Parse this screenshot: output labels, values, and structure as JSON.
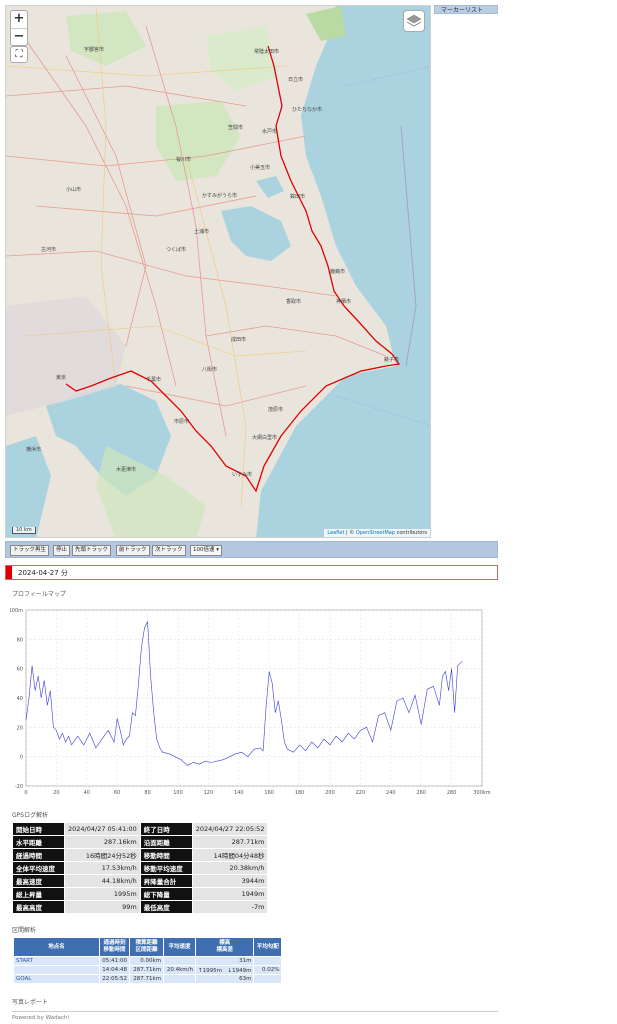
{
  "map": {
    "zoom_in": "+",
    "zoom_out": "−",
    "fullscreen": "⛶",
    "scale_label": "10 km",
    "attribution_leaflet": "Leaflet",
    "attribution_sep": " | © ",
    "attribution_osm": "OpenStreetMap",
    "attribution_tail": " contributors",
    "labels": [
      {
        "text": "宇都宮市"
      },
      {
        "text": "常陸太田市"
      },
      {
        "text": "日立市"
      },
      {
        "text": "ひたちなか市"
      },
      {
        "text": "水戸市"
      },
      {
        "text": "笠間市"
      },
      {
        "text": "小美玉市"
      },
      {
        "text": "鉾田市"
      },
      {
        "text": "かすみがうら市"
      },
      {
        "text": "土浦市"
      },
      {
        "text": "つくば市"
      },
      {
        "text": "鹿嶋市"
      },
      {
        "text": "神栖市"
      },
      {
        "text": "香取市"
      },
      {
        "text": "銚子市"
      },
      {
        "text": "成田市"
      },
      {
        "text": "八街市"
      },
      {
        "text": "千葉市"
      },
      {
        "text": "東京"
      },
      {
        "text": "市原市"
      },
      {
        "text": "茂原市"
      },
      {
        "text": "木更津市"
      },
      {
        "text": "大網白里市"
      },
      {
        "text": "いすみ市"
      },
      {
        "text": "横浜市"
      },
      {
        "text": "小山市"
      },
      {
        "text": "古河市"
      },
      {
        "text": "桜川市"
      }
    ]
  },
  "marker_list": {
    "title": "マーカーリスト"
  },
  "toolbar": {
    "play_track": "トラック再生",
    "stop": "停止",
    "first_track": "先頭トラック",
    "prev_track": "前トラック",
    "next_track": "次トラック",
    "speed_select": "100倍速"
  },
  "date_bar": {
    "label": "2024-04-27 分"
  },
  "profile": {
    "title": "プロフィールマップ",
    "y_unit": "m",
    "x_unit": "km"
  },
  "chart_data": {
    "type": "line",
    "title": "",
    "xlabel": "",
    "ylabel": "",
    "xlim": [
      0,
      300
    ],
    "ylim": [
      -20,
      100
    ],
    "xticks": [
      0,
      20,
      40,
      60,
      80,
      100,
      120,
      140,
      160,
      180,
      200,
      220,
      240,
      260,
      280,
      300
    ],
    "yticks": [
      -20,
      0,
      20,
      40,
      60,
      80,
      100
    ],
    "grid": true,
    "series": [
      {
        "color": "#3b3bdc",
        "x": [
          0,
          2,
          4,
          6,
          8,
          10,
          12,
          14,
          16,
          18,
          20,
          22,
          24,
          26,
          28,
          30,
          34,
          38,
          42,
          46,
          50,
          54,
          58,
          60,
          62,
          64,
          66,
          68,
          70,
          72,
          74,
          76,
          78,
          80,
          82,
          84,
          86,
          88,
          90,
          94,
          98,
          102,
          106,
          110,
          114,
          118,
          122,
          126,
          130,
          134,
          138,
          142,
          146,
          150,
          154,
          156,
          158,
          160,
          162,
          164,
          166,
          168,
          170,
          172,
          176,
          180,
          184,
          188,
          192,
          196,
          200,
          204,
          208,
          212,
          216,
          220,
          224,
          228,
          232,
          236,
          240,
          244,
          248,
          252,
          256,
          260,
          264,
          268,
          272,
          274,
          276,
          278,
          280,
          282,
          284,
          287
        ],
        "y": [
          25,
          40,
          62,
          45,
          55,
          40,
          52,
          35,
          45,
          20,
          18,
          12,
          16,
          10,
          14,
          8,
          14,
          8,
          16,
          6,
          12,
          18,
          10,
          26,
          18,
          8,
          12,
          14,
          30,
          28,
          50,
          75,
          88,
          92,
          55,
          30,
          12,
          6,
          3,
          2,
          0,
          -2,
          -6,
          -4,
          -5,
          -3,
          -4,
          -3,
          -2,
          0,
          2,
          3,
          0,
          5,
          6,
          4,
          35,
          58,
          50,
          30,
          38,
          25,
          10,
          5,
          3,
          8,
          4,
          10,
          6,
          12,
          8,
          14,
          10,
          16,
          12,
          18,
          20,
          10,
          28,
          30,
          18,
          38,
          40,
          30,
          42,
          22,
          46,
          48,
          35,
          55,
          58,
          45,
          60,
          30,
          62,
          65
        ]
      }
    ]
  },
  "gps": {
    "title": "GPSログ解析",
    "rows": [
      {
        "l1": "開始日時",
        "v1": "2024/04/27 05:41:00",
        "l2": "終了日時",
        "v2": "2024/04/27 22:05:52"
      },
      {
        "l1": "水平距離",
        "v1": "287.16km",
        "l2": "沿面距離",
        "v2": "287.71km"
      },
      {
        "l1": "経過時間",
        "v1": "16時間24分52秒",
        "l2": "移動時間",
        "v2": "14時間04分48秒"
      },
      {
        "l1": "全体平均速度",
        "v1": "17.53km/h",
        "l2": "移動平均速度",
        "v2": "20.38km/h"
      },
      {
        "l1": "最高速度",
        "v1": "44.18km/h",
        "l2": "昇降量合計",
        "v2": "3944m"
      },
      {
        "l1": "総上昇量",
        "v1": "1995m",
        "l2": "総下降量",
        "v2": "1949m"
      },
      {
        "l1": "最高高度",
        "v1": "99m",
        "l2": "最低高度",
        "v2": "-7m"
      }
    ]
  },
  "segments": {
    "title": "区間解析",
    "headers": {
      "name": "地点名",
      "time_a": "通過時刻",
      "time_b": "移動時間",
      "dist_a": "積算距離",
      "dist_b": "区間距離",
      "speed": "平均速度",
      "elev_a": "標高",
      "elev_b": "標高差",
      "grade": "平均勾配"
    },
    "rows": [
      {
        "name": "START",
        "time": "05:41:00",
        "dist": "0.00km",
        "speed": "",
        "elev": "31m",
        "grade": ""
      },
      {
        "name": "",
        "time": "14:04:48",
        "dist": "287.71km",
        "speed": "20.4km/h",
        "elev": "↑1995m　↓1949m",
        "grade": "0.02%"
      },
      {
        "name": "GOAL",
        "time": "22:05:52",
        "dist": "287.71km",
        "speed": "",
        "elev": "63m",
        "grade": ""
      }
    ]
  },
  "photo_report": {
    "title": "写真レポート"
  },
  "footer": {
    "text": "Powered by Wadachi"
  }
}
